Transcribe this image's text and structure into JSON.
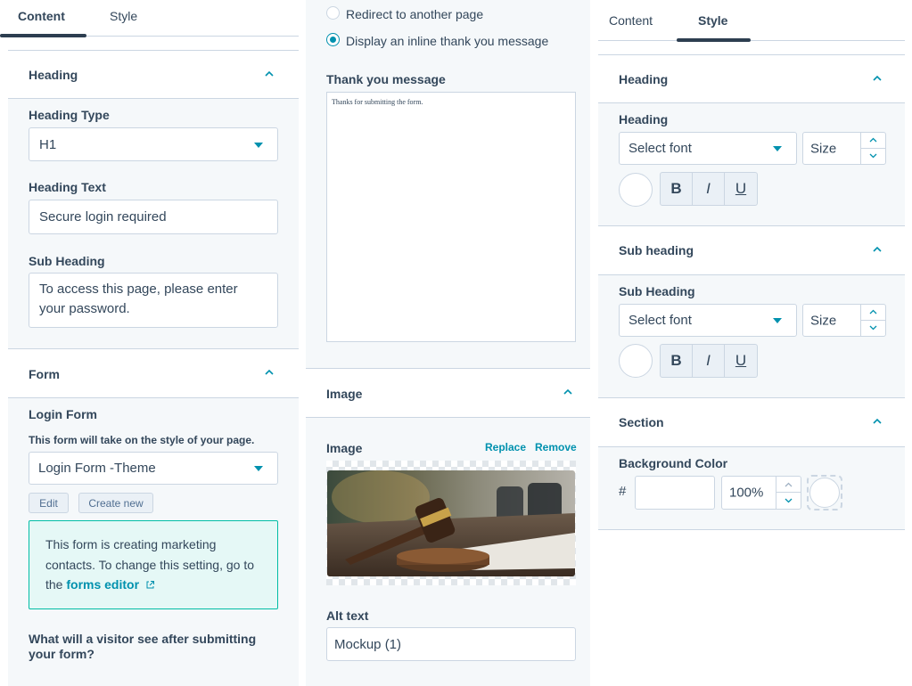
{
  "left_panel": {
    "tabs": [
      {
        "label": "Content"
      },
      {
        "label": "Style"
      }
    ],
    "heading_section": {
      "title": "Heading",
      "heading_type_label": "Heading Type",
      "heading_type_value": "H1",
      "heading_text_label": "Heading Text",
      "heading_text_value": "Secure login required",
      "sub_heading_label": "Sub Heading",
      "sub_heading_line1": "To access this page, please enter",
      "sub_heading_line2": "your password."
    },
    "form_section": {
      "title": "Form",
      "login_form_label": "Login Form",
      "style_note": "This form will take on the style of your page.",
      "form_select_value": "Login Form -Theme",
      "edit_label": "Edit",
      "create_new_label": "Create new",
      "callout_line1": "This form is creating marketing",
      "callout_line2": "contacts. To change this setting, go to",
      "callout_prefix": "the",
      "callout_link": "forms editor",
      "after_submit_line1": "What will a visitor see after submitting",
      "after_submit_line2": "your form?"
    }
  },
  "middle_panel": {
    "radio_redirect_label": "Redirect to another page",
    "radio_inline_label": "Display an inline thank you message",
    "thank_you_label": "Thank you message",
    "thank_you_text": "Thanks for submitting the form.",
    "image_section_title": "Image",
    "image_label": "Image",
    "replace_label": "Replace",
    "remove_label": "Remove",
    "alt_text_label": "Alt text",
    "alt_text_value": "Mockup (1)"
  },
  "right_panel": {
    "tabs": [
      {
        "label": "Content"
      },
      {
        "label": "Style"
      }
    ],
    "heading_section": {
      "title": "Heading",
      "field_label": "Heading",
      "font_placeholder": "Select font",
      "size_placeholder": "Size",
      "bold": "B",
      "italic": "I",
      "underline": "U"
    },
    "sub_heading_section": {
      "title": "Sub heading",
      "field_label": "Sub Heading",
      "font_placeholder": "Select font",
      "size_placeholder": "Size",
      "bold": "B",
      "italic": "I",
      "underline": "U"
    },
    "section_section": {
      "title": "Section",
      "bg_label": "Background Color",
      "hash": "#",
      "opacity_value": "100%"
    }
  },
  "colors": {
    "accent": "#0091ae",
    "text": "#33475b",
    "border": "#cbd6e2",
    "callout_bg": "#e5f8f6",
    "callout_border": "#00bda5"
  }
}
